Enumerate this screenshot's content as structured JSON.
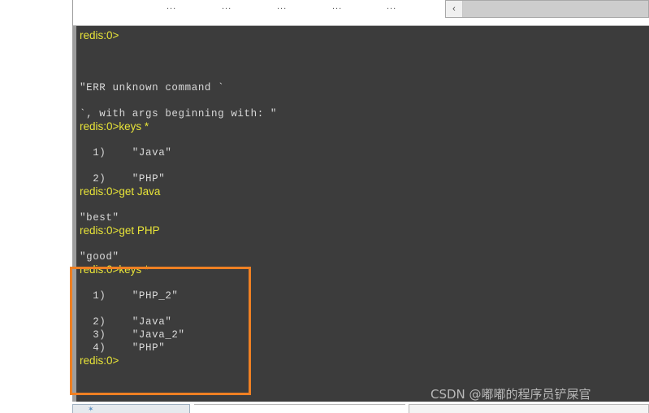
{
  "colors": {
    "console_bg": "#3c3c3c",
    "prompt_text": "#e8e438",
    "output_text": "#d9d9d9",
    "annotation_border": "#ef8023",
    "watermark_text": "#b9b9b9",
    "scrollbar_track": "#cdcdcd"
  },
  "header": {
    "column_markers": [
      "...",
      "...",
      "...",
      "...",
      "..."
    ],
    "scrollbar": {
      "left_arrow_glyph": "‹"
    }
  },
  "console": {
    "lines": [
      {
        "kind": "prompt",
        "text": "redis:0>"
      },
      {
        "kind": "blank",
        "text": ""
      },
      {
        "kind": "blank",
        "text": ""
      },
      {
        "kind": "blank",
        "text": ""
      },
      {
        "kind": "output",
        "text": "\"ERR unknown command `"
      },
      {
        "kind": "blank",
        "text": ""
      },
      {
        "kind": "output",
        "text": "`, with args beginning with: \""
      },
      {
        "kind": "prompt",
        "text": "redis:0>keys *"
      },
      {
        "kind": "blank",
        "text": ""
      },
      {
        "kind": "output",
        "text": "  1)    \"Java\""
      },
      {
        "kind": "blank",
        "text": ""
      },
      {
        "kind": "output",
        "text": "  2)    \"PHP\""
      },
      {
        "kind": "prompt",
        "text": "redis:0>get Java"
      },
      {
        "kind": "blank",
        "text": ""
      },
      {
        "kind": "output",
        "text": "\"best\""
      },
      {
        "kind": "prompt",
        "text": "redis:0>get PHP"
      },
      {
        "kind": "blank",
        "text": ""
      },
      {
        "kind": "output",
        "text": "\"good\""
      },
      {
        "kind": "prompt",
        "text": "redis:0>keys *"
      },
      {
        "kind": "blank",
        "text": ""
      },
      {
        "kind": "output",
        "text": "  1)    \"PHP_2\""
      },
      {
        "kind": "blank",
        "text": ""
      },
      {
        "kind": "output",
        "text": "  2)    \"Java\""
      },
      {
        "kind": "output",
        "text": "  3)    \"Java_2\""
      },
      {
        "kind": "output",
        "text": "  4)    \"PHP\""
      },
      {
        "kind": "prompt",
        "text": "redis:0>"
      }
    ]
  },
  "annotation": {
    "label": "highlighted-keys-result"
  },
  "watermark": {
    "text": "CSDN @嘟嘟的程序员铲屎官"
  },
  "bottom": {
    "tab_icon_glyph": "✶"
  }
}
